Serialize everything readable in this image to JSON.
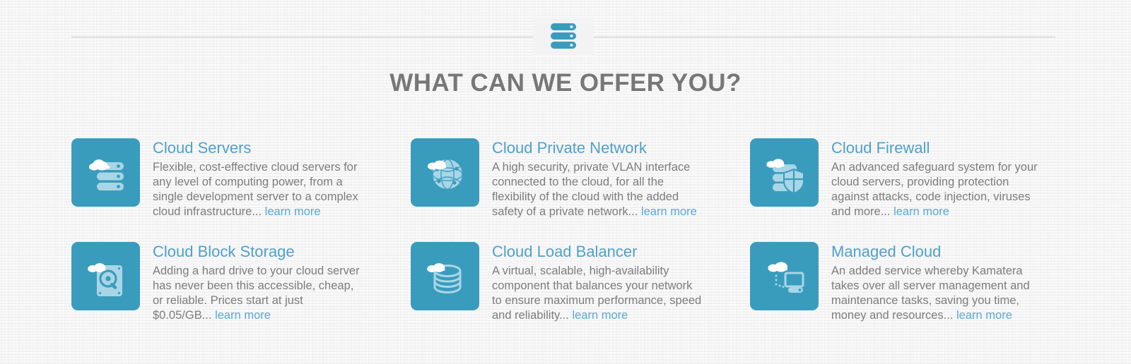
{
  "section": {
    "heading": "WHAT CAN WE OFFER YOU?",
    "badge_icon": "server-stack-icon",
    "learn_more_label": "learn more"
  },
  "colors": {
    "page_background": "#f3f3f3",
    "icon_tile": "#3a9cbd",
    "title_blue": "#4ea1cd",
    "link_blue": "#5aa8d4",
    "heading_gray": "#777777",
    "body_gray": "#7d7d7d",
    "divider_gray": "#c9c9c9"
  },
  "features": [
    {
      "id": "cloud-servers",
      "title": "Cloud Servers",
      "icon": "cloud-server-icon",
      "description": "Flexible, cost-effective cloud servers for any level of computing power, from a single development server to a complex cloud infrastructure...",
      "link": "learn more"
    },
    {
      "id": "cloud-private-network",
      "title": "Cloud Private Network",
      "icon": "cloud-network-globe-icon",
      "description": "A high security, private VLAN interface connected to the cloud, for all the flexibility of the cloud with the added safety of a private network...",
      "link": "learn more"
    },
    {
      "id": "cloud-firewall",
      "title": "Cloud Firewall",
      "icon": "cloud-shield-icon",
      "description": "An advanced safeguard system for your cloud servers, providing protection against attacks, code injection, viruses and more...",
      "link": "learn more"
    },
    {
      "id": "cloud-block-storage",
      "title": "Cloud Block Storage",
      "icon": "cloud-harddrive-icon",
      "description": "Adding a hard drive to your cloud server has never been this accessible, cheap, or reliable. Prices start at just $0.05/GB...",
      "link": "learn more"
    },
    {
      "id": "cloud-load-balancer",
      "title": "Cloud Load Balancer",
      "icon": "cloud-database-icon",
      "description": "A virtual, scalable, high-availability component that balances your network to ensure maximum performance, speed and reliability...",
      "link": "learn more"
    },
    {
      "id": "managed-cloud",
      "title": "Managed Cloud",
      "icon": "cloud-monitor-icon",
      "description": "An added service whereby Kamatera takes over all server management and maintenance tasks, saving you time, money and resources...",
      "link": "learn more"
    }
  ]
}
